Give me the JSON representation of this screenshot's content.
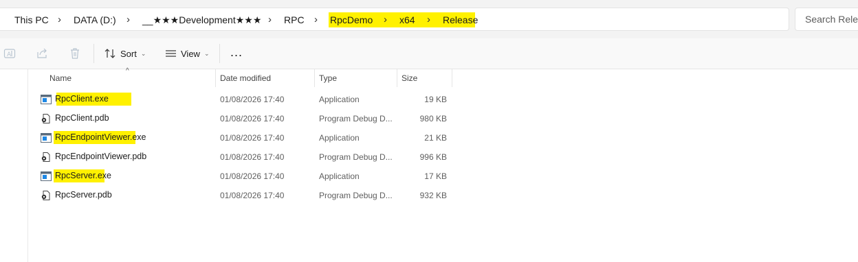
{
  "breadcrumb": {
    "items": [
      "This PC",
      "DATA (D:)",
      "__★★★Development★★★",
      "RPC",
      "RpcDemo",
      "x64",
      "Release"
    ]
  },
  "search": {
    "placeholder": "Search Release"
  },
  "toolbar": {
    "sort_label": "Sort",
    "view_label": "View",
    "more_label": "..."
  },
  "columns": {
    "name": "Name",
    "date": "Date modified",
    "type": "Type",
    "size": "Size"
  },
  "files": [
    {
      "name": "RpcClient.exe",
      "date": "01/08/2026 17:40",
      "type": "Application",
      "size": "19 KB",
      "icon": "exe-icon"
    },
    {
      "name": "RpcClient.pdb",
      "date": "01/08/2026 17:40",
      "type": "Program Debug D...",
      "size": "980 KB",
      "icon": "pdb-file-icon"
    },
    {
      "name": "RpcEndpointViewer.exe",
      "date": "01/08/2026 17:40",
      "type": "Application",
      "size": "21 KB",
      "icon": "exe-icon"
    },
    {
      "name": "RpcEndpointViewer.pdb",
      "date": "01/08/2026 17:40",
      "type": "Program Debug D...",
      "size": "996 KB",
      "icon": "pdb-file-icon"
    },
    {
      "name": "RpcServer.exe",
      "date": "01/08/2026 17:40",
      "type": "Application",
      "size": "17 KB",
      "icon": "exe-icon"
    },
    {
      "name": "RpcServer.pdb",
      "date": "01/08/2026 17:40",
      "type": "Program Debug D...",
      "size": "932 KB",
      "icon": "pdb-file-icon"
    }
  ],
  "colors": {
    "highlight": "#fff100",
    "accent": "#0067c0"
  }
}
